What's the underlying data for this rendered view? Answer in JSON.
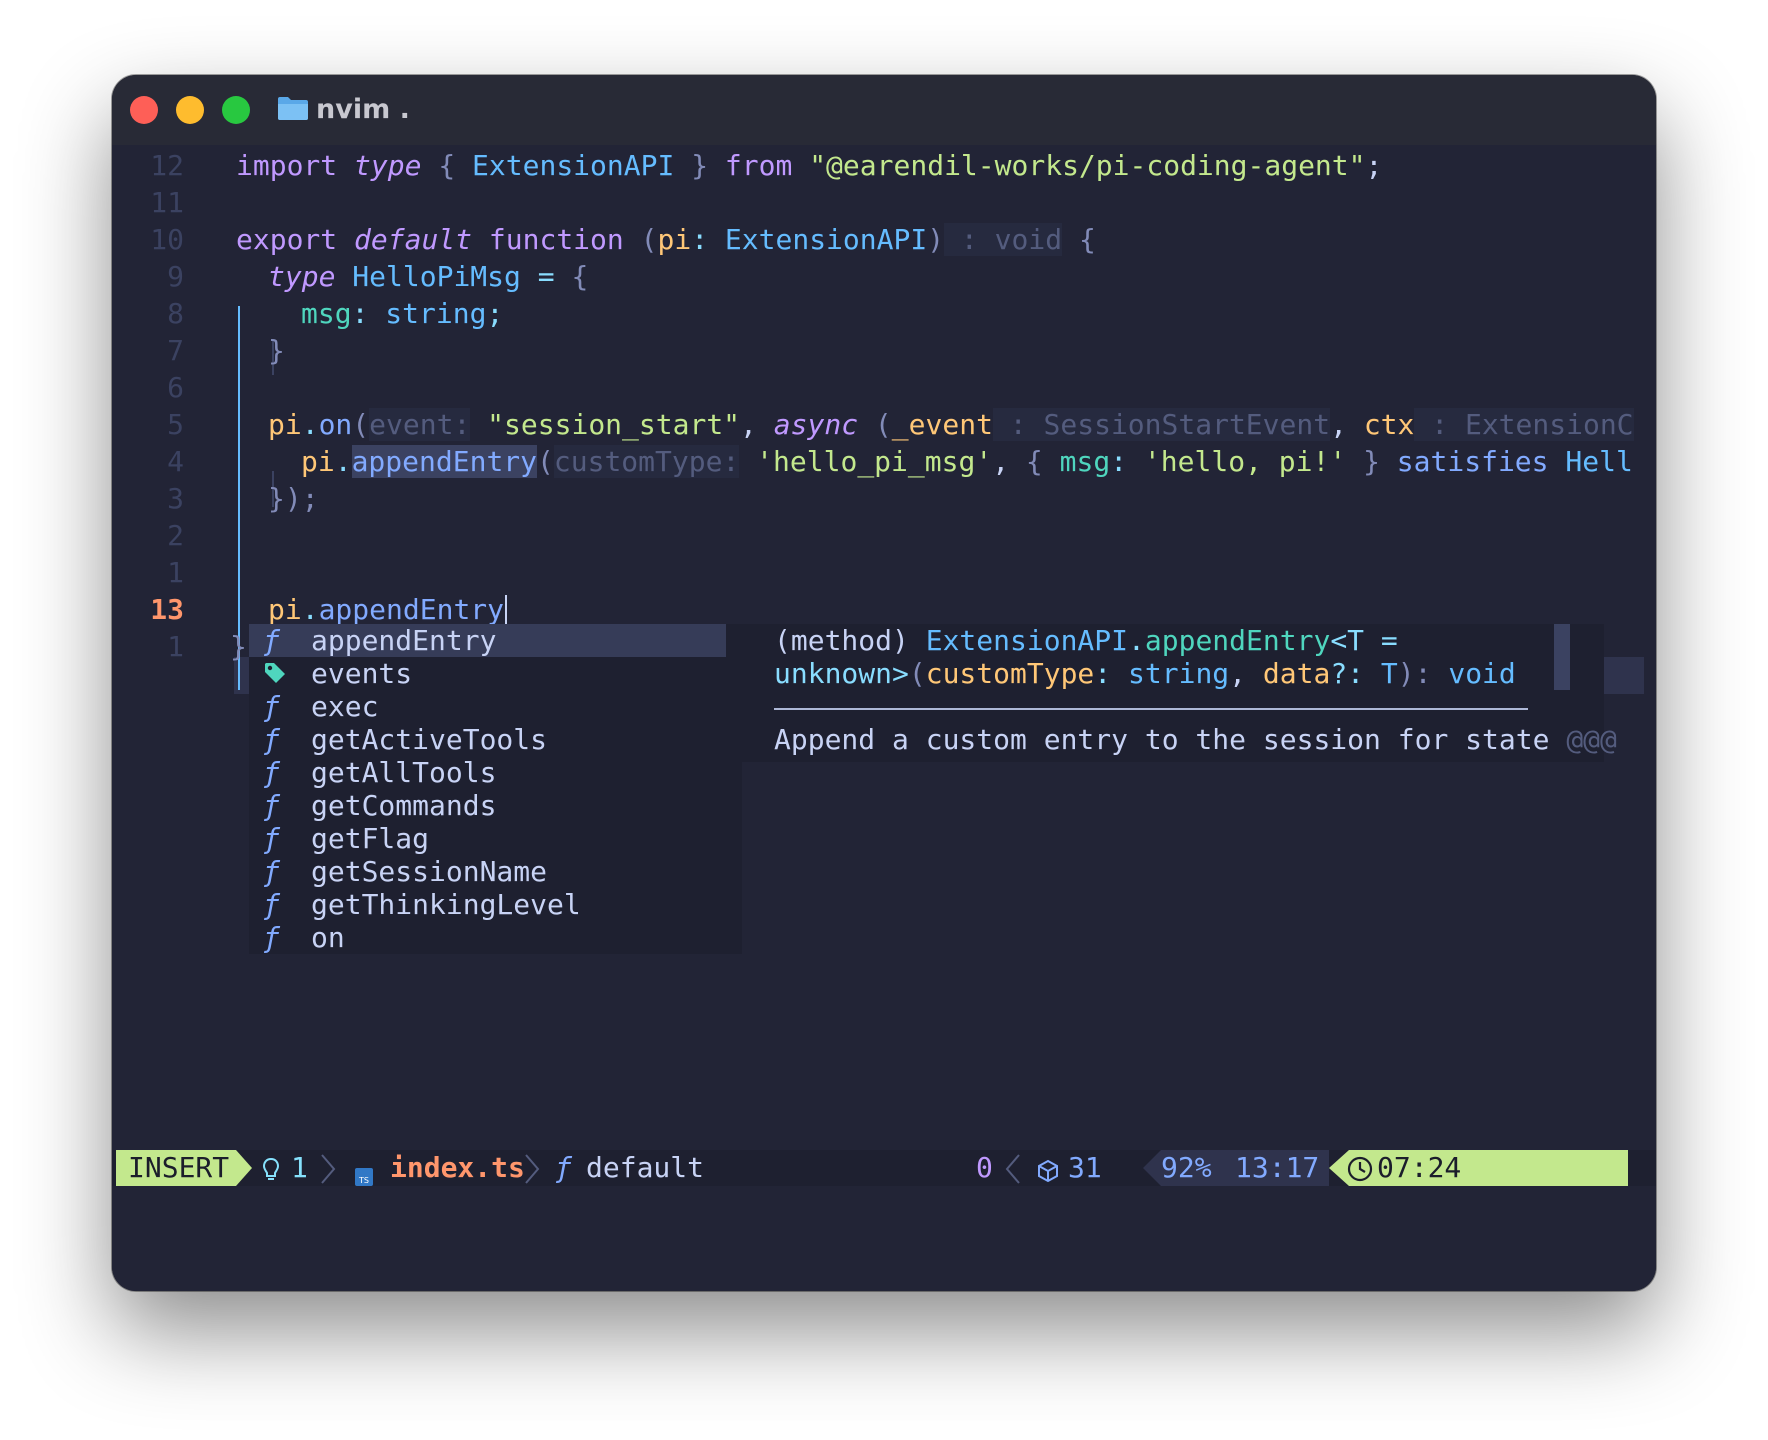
{
  "window": {
    "title": "nvim ."
  },
  "editor": {
    "line_numbers": [
      "12",
      "11",
      "10",
      "9",
      "8",
      "7",
      "6",
      "5",
      "4",
      "3",
      "2",
      "1",
      "13",
      "1"
    ],
    "code": {
      "l12": {
        "kw_import": "import",
        "kw_type": "type",
        "brace_open": "{",
        "name": "ExtensionAPI",
        "brace_close": "}",
        "kw_from": "from",
        "module": "\"@earendil-works/pi-coding-agent\"",
        "semi": ";"
      },
      "l10": {
        "kw_export": "export",
        "kw_default": "default",
        "kw_function": "function",
        "paren_open": "(",
        "param": "pi",
        "colon": ":",
        "param_type": "ExtensionAPI",
        "paren_close": ")",
        "return_hint": " : void",
        "brace": "{"
      },
      "l9": {
        "kw_type": "type",
        "name": "HelloPiMsg",
        "eq": "=",
        "brace": "{"
      },
      "l8": {
        "field": "msg",
        "colon": ":",
        "field_type": "string",
        "semi": ";"
      },
      "l7": {
        "brace": "}"
      },
      "l5": {
        "obj": "pi",
        "dot": ".",
        "method": "on",
        "paren": "(",
        "hint": "event:",
        "event": "\"session_start\"",
        "comma": ",",
        "kw_async": "async",
        "paren2": "(",
        "p1": "_event",
        "hint1": " : SessionStartEvent",
        "comma2": ",",
        "p2": "ctx",
        "hint2": " : ExtensionC"
      },
      "l4": {
        "obj": "pi",
        "dot": ".",
        "method": "appendEntry",
        "paren": "(",
        "hint": "customType:",
        "arg1": "'hello_pi_msg'",
        "comma": ",",
        "brace_open": "{",
        "key": "msg",
        "colon": ":",
        "val": "'hello, pi!'",
        "brace_close": "}",
        "kw_satisfies": "satisfies",
        "type_ref": "Hell"
      },
      "l3": {
        "close": "});"
      },
      "l13": {
        "obj": "pi",
        "dot": ".",
        "method": "appendEntry"
      },
      "l1b": {
        "brace": "}"
      }
    }
  },
  "completion": {
    "items": [
      {
        "icon": "function-icon",
        "glyph": "ƒ",
        "label": "appendEntry",
        "selected": true
      },
      {
        "icon": "tag-icon",
        "glyph": "",
        "label": "events"
      },
      {
        "icon": "function-icon",
        "glyph": "ƒ",
        "label": "exec"
      },
      {
        "icon": "function-icon",
        "glyph": "ƒ",
        "label": "getActiveTools"
      },
      {
        "icon": "function-icon",
        "glyph": "ƒ",
        "label": "getAllTools"
      },
      {
        "icon": "function-icon",
        "glyph": "ƒ",
        "label": "getCommands"
      },
      {
        "icon": "function-icon",
        "glyph": "ƒ",
        "label": "getFlag"
      },
      {
        "icon": "function-icon",
        "glyph": "ƒ",
        "label": "getSessionName"
      },
      {
        "icon": "function-icon",
        "glyph": "ƒ",
        "label": "getThinkingLevel"
      },
      {
        "icon": "function-icon",
        "glyph": "ƒ",
        "label": "on"
      }
    ]
  },
  "doc": {
    "sig1": {
      "kind": "(method)",
      "iface": "ExtensionAPI",
      "dot": ".",
      "method": "appendEntry",
      "generic": "<T ="
    },
    "sig2": {
      "unknown": "unknown>",
      "paren": "(",
      "p1": "customType",
      "colon1": ":",
      "t1": "string",
      "comma": ",",
      "p2": "data",
      "opt": "?:",
      "t2": "T",
      "close": "):",
      "ret": "void"
    },
    "description": "Append a custom entry to the session for state",
    "overflow": "@@@"
  },
  "statusbar": {
    "mode": "INSERT",
    "diagnostics": "1",
    "filename": "index.ts",
    "symbol": "default",
    "count": "0",
    "lsp_count": "31",
    "percent": "92%",
    "position": "13:17",
    "time": "07:24"
  },
  "colors": {
    "background": "#222436",
    "mode_insert": "#c3e88d",
    "line_number_current": "#ff966c",
    "filename": "#ff966c"
  }
}
